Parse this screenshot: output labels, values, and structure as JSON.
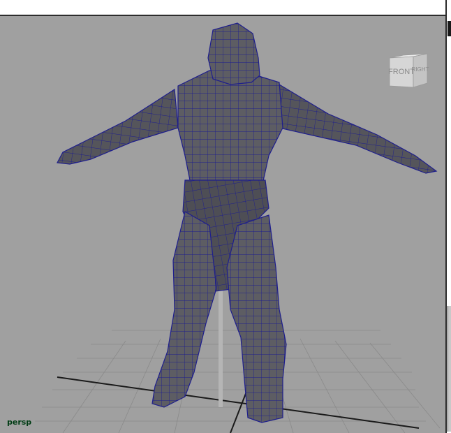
{
  "viewport": {
    "camera_label": "persp",
    "background_color": "#a0a0a0",
    "wireframe_color": "#1e1e8c",
    "mesh_color": "#6a6a6a"
  },
  "viewcube": {
    "front_label": "FRONT",
    "right_label": "RIGHT"
  }
}
